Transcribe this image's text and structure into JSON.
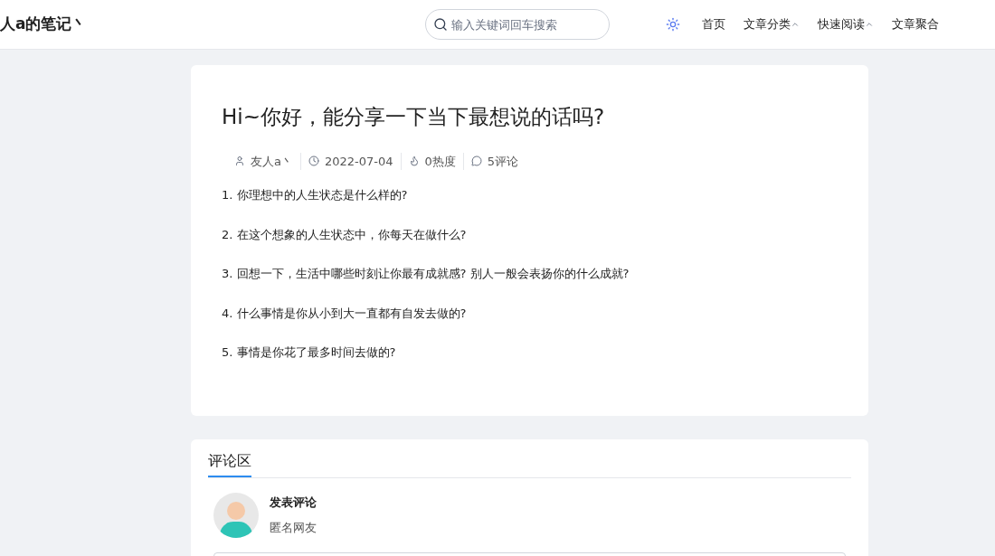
{
  "header": {
    "logo": "人a的笔记丶",
    "search": {
      "placeholder": "输入关键词回车搜索"
    },
    "nav": [
      {
        "label": "首页",
        "dropdown": false
      },
      {
        "label": "文章分类",
        "dropdown": true
      },
      {
        "label": "快速阅读",
        "dropdown": true
      },
      {
        "label": "文章聚合",
        "dropdown": false
      }
    ]
  },
  "article": {
    "title": "Hi~你好，能分享一下当下最想说的话吗?",
    "meta": [
      {
        "kind": "author",
        "text": "友人a丶"
      },
      {
        "kind": "date",
        "text": "2022-07-04"
      },
      {
        "kind": "heat",
        "text": "0热度"
      },
      {
        "kind": "comments",
        "text": "5评论"
      }
    ],
    "paragraphs": [
      "1. 你理想中的人生状态是什么样的?",
      "2. 在这个想象的人生状态中，你每天在做什么?",
      "3. 回想一下，生活中哪些时刻让你最有成就感? 别人一般会表扬你的什么成就?",
      "4. 什么事情是你从小到大一直都有自发去做的?",
      "5. 事情是你花了最多时间去做的?"
    ]
  },
  "comments": {
    "tab": "评论区",
    "heading": "发表评论",
    "user": "匿名网友"
  }
}
